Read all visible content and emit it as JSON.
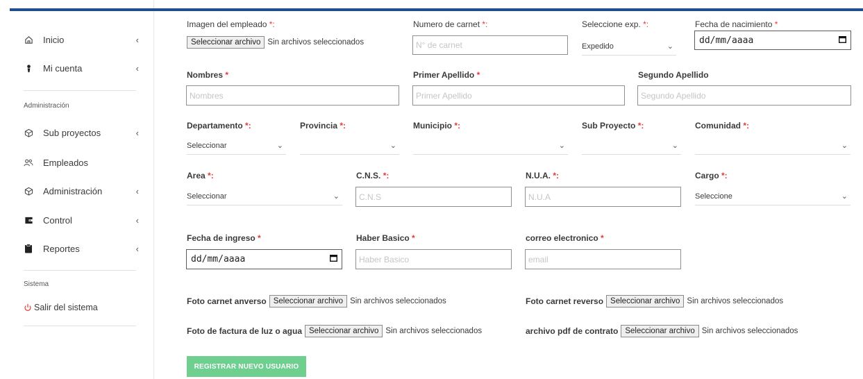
{
  "sidebar": {
    "items": [
      {
        "label": "Inicio",
        "icon": "home-icon"
      },
      {
        "label": "Mi cuenta",
        "icon": "user-icon"
      },
      {
        "label": "Sub proyectos",
        "icon": "cube-icon"
      },
      {
        "label": "Empleados",
        "icon": "users-icon"
      },
      {
        "label": "Administración",
        "icon": "cube-icon"
      },
      {
        "label": "Control",
        "icon": "wallet-icon"
      },
      {
        "label": "Reportes",
        "icon": "clipboard-icon"
      }
    ],
    "section_admin": "Administración",
    "section_system": "Sistema",
    "logout_label": "Salir del sistema",
    "chevron": "‹"
  },
  "form": {
    "employee_image": {
      "label": "Imagen del empleado",
      "req": "*:",
      "button": "Seleccionar archivo",
      "status": "Sin archivos seleccionados"
    },
    "carnet": {
      "label": "Numero de carnet",
      "req": "*:",
      "placeholder": "N° de carnet"
    },
    "expedition": {
      "label": "Seleccione exp.",
      "req": "*:",
      "value": "Expedido"
    },
    "birth_date": {
      "label": "Fecha de nacimiento",
      "req": "*",
      "value": "dd/mm/aaaa"
    },
    "names": {
      "label": "Nombres",
      "req": "*",
      "placeholder": "Nombres"
    },
    "first_surname": {
      "label": "Primer Apellido",
      "req": "*",
      "placeholder": "Primer Apellido"
    },
    "second_surname": {
      "label": "Segundo Apellido",
      "placeholder": "Segundo Apellido"
    },
    "department": {
      "label": "Departamento",
      "req": "*:",
      "value": "Seleccionar"
    },
    "province": {
      "label": "Provincia",
      "req": "*:",
      "value": ""
    },
    "municipality": {
      "label": "Municipio",
      "req": "*:",
      "value": ""
    },
    "subproject": {
      "label": "Sub Proyecto",
      "req": "*:",
      "value": ""
    },
    "community": {
      "label": "Comunidad",
      "req": "*:",
      "value": ""
    },
    "area": {
      "label": "Area",
      "req": "*:",
      "value": "Seleccionar"
    },
    "cns": {
      "label": "C.N.S.",
      "req": "*:",
      "placeholder": "C.N.S"
    },
    "nua": {
      "label": "N.U.A.",
      "req": "*:",
      "placeholder": "N.U.A"
    },
    "position": {
      "label": "Cargo",
      "req": "*:",
      "value": "Seleccione"
    },
    "hire_date": {
      "label": "Fecha de ingreso",
      "req": "*",
      "value": "dd/mm/aaaa"
    },
    "salary": {
      "label": "Haber Basico",
      "req": "*",
      "placeholder": "Haber Basico"
    },
    "email": {
      "label": "correo electronico",
      "req": "*",
      "placeholder": "email"
    },
    "id_front": {
      "label": "Foto carnet anverso",
      "button": "Seleccionar archivo",
      "status": "Sin archivos seleccionados"
    },
    "id_back": {
      "label": "Foto carnet reverso",
      "button": "Seleccionar archivo",
      "status": "Sin archivos seleccionados"
    },
    "utility_bill": {
      "label": "Foto de factura de luz o agua",
      "button": "Seleccionar archivo",
      "status": "Sin archivos seleccionados"
    },
    "contract_pdf": {
      "label": "archivo pdf de contrato",
      "button": "Seleccionar archivo",
      "status": "Sin archivos seleccionados"
    },
    "submit": "REGISTRAR NUEVO USUARIO",
    "chevron_down": "⌄"
  },
  "colors": {
    "accent": "#1f4e8c",
    "required": "#e53935",
    "submit": "#6ecf8f"
  }
}
